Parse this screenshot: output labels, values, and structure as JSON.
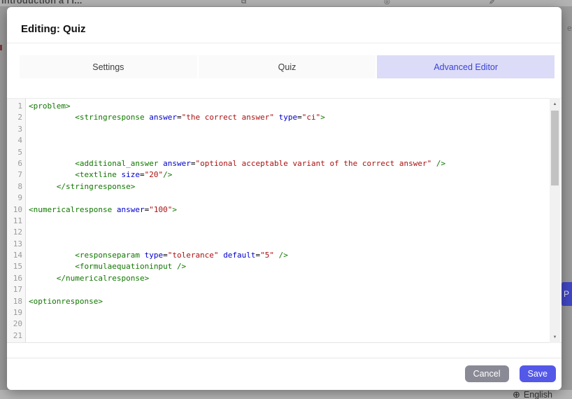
{
  "background_page": {
    "title_fragment": "Introduction à l'I...",
    "right_edge_fragment": "e",
    "cropped_button_text": "P",
    "language_label": "English",
    "globe_glyph": "⊕",
    "icons": {
      "copy": "⧉",
      "eye": "◎",
      "pencil": "✎"
    }
  },
  "modal": {
    "title": "Editing: Quiz",
    "tabs": [
      {
        "label": "Settings",
        "active": false
      },
      {
        "label": "Quiz",
        "active": false
      },
      {
        "label": "Advanced Editor",
        "active": true
      }
    ],
    "footer": {
      "cancel_label": "Cancel",
      "save_label": "Save"
    }
  },
  "editor": {
    "language": "xml",
    "scroll_up_glyph": "▲",
    "scroll_down_glyph": "▼",
    "lines": [
      {
        "n": 1,
        "tokens": [
          {
            "t": "tag",
            "v": "<problem>"
          }
        ]
      },
      {
        "n": 2,
        "tokens": [
          {
            "t": "pln",
            "v": "          "
          },
          {
            "t": "tag",
            "v": "<stringresponse"
          },
          {
            "t": "pln",
            "v": " "
          },
          {
            "t": "att",
            "v": "answer"
          },
          {
            "t": "pln",
            "v": "="
          },
          {
            "t": "str",
            "v": "\"the correct answer\""
          },
          {
            "t": "pln",
            "v": " "
          },
          {
            "t": "att",
            "v": "type"
          },
          {
            "t": "pln",
            "v": "="
          },
          {
            "t": "str",
            "v": "\"ci\""
          },
          {
            "t": "tag",
            "v": ">"
          }
        ]
      },
      {
        "n": 3,
        "tokens": []
      },
      {
        "n": 4,
        "tokens": []
      },
      {
        "n": 5,
        "tokens": []
      },
      {
        "n": 6,
        "tokens": [
          {
            "t": "pln",
            "v": "          "
          },
          {
            "t": "tag",
            "v": "<additional_answer"
          },
          {
            "t": "pln",
            "v": " "
          },
          {
            "t": "att",
            "v": "answer"
          },
          {
            "t": "pln",
            "v": "="
          },
          {
            "t": "str",
            "v": "\"optional acceptable variant of the correct answer\""
          },
          {
            "t": "pln",
            "v": " "
          },
          {
            "t": "tag",
            "v": "/>"
          }
        ]
      },
      {
        "n": 7,
        "tokens": [
          {
            "t": "pln",
            "v": "          "
          },
          {
            "t": "tag",
            "v": "<textline"
          },
          {
            "t": "pln",
            "v": " "
          },
          {
            "t": "att",
            "v": "size"
          },
          {
            "t": "pln",
            "v": "="
          },
          {
            "t": "str",
            "v": "\"20\""
          },
          {
            "t": "tag",
            "v": "/>"
          }
        ]
      },
      {
        "n": 8,
        "tokens": [
          {
            "t": "pln",
            "v": "      "
          },
          {
            "t": "tag",
            "v": "</stringresponse>"
          }
        ]
      },
      {
        "n": 9,
        "tokens": []
      },
      {
        "n": 10,
        "tokens": [
          {
            "t": "tag",
            "v": "<numericalresponse"
          },
          {
            "t": "pln",
            "v": " "
          },
          {
            "t": "att",
            "v": "answer"
          },
          {
            "t": "pln",
            "v": "="
          },
          {
            "t": "str",
            "v": "\"100\""
          },
          {
            "t": "tag",
            "v": ">"
          }
        ]
      },
      {
        "n": 11,
        "tokens": []
      },
      {
        "n": 12,
        "tokens": []
      },
      {
        "n": 13,
        "tokens": []
      },
      {
        "n": 14,
        "tokens": [
          {
            "t": "pln",
            "v": "          "
          },
          {
            "t": "tag",
            "v": "<responseparam"
          },
          {
            "t": "pln",
            "v": " "
          },
          {
            "t": "att",
            "v": "type"
          },
          {
            "t": "pln",
            "v": "="
          },
          {
            "t": "str",
            "v": "\"tolerance\""
          },
          {
            "t": "pln",
            "v": " "
          },
          {
            "t": "att",
            "v": "default"
          },
          {
            "t": "pln",
            "v": "="
          },
          {
            "t": "str",
            "v": "\"5\""
          },
          {
            "t": "pln",
            "v": " "
          },
          {
            "t": "tag",
            "v": "/>"
          }
        ]
      },
      {
        "n": 15,
        "tokens": [
          {
            "t": "pln",
            "v": "          "
          },
          {
            "t": "tag",
            "v": "<formulaequationinput"
          },
          {
            "t": "pln",
            "v": " "
          },
          {
            "t": "tag",
            "v": "/>"
          }
        ]
      },
      {
        "n": 16,
        "tokens": [
          {
            "t": "pln",
            "v": "      "
          },
          {
            "t": "tag",
            "v": "</numericalresponse>"
          }
        ]
      },
      {
        "n": 17,
        "tokens": []
      },
      {
        "n": 18,
        "tokens": [
          {
            "t": "tag",
            "v": "<optionresponse>"
          }
        ]
      },
      {
        "n": 19,
        "tokens": []
      },
      {
        "n": 20,
        "tokens": []
      },
      {
        "n": 21,
        "tokens": []
      }
    ]
  },
  "colors": {
    "accent": "#5458e8",
    "cancel_button": "#8a8a96",
    "active_tab_bg": "#dcdcf8",
    "active_tab_text": "#3b43d6",
    "syntax_tag": "#117700",
    "syntax_attribute": "#0000cc",
    "syntax_string": "#aa1111",
    "overlay": "#9b9b9b"
  }
}
